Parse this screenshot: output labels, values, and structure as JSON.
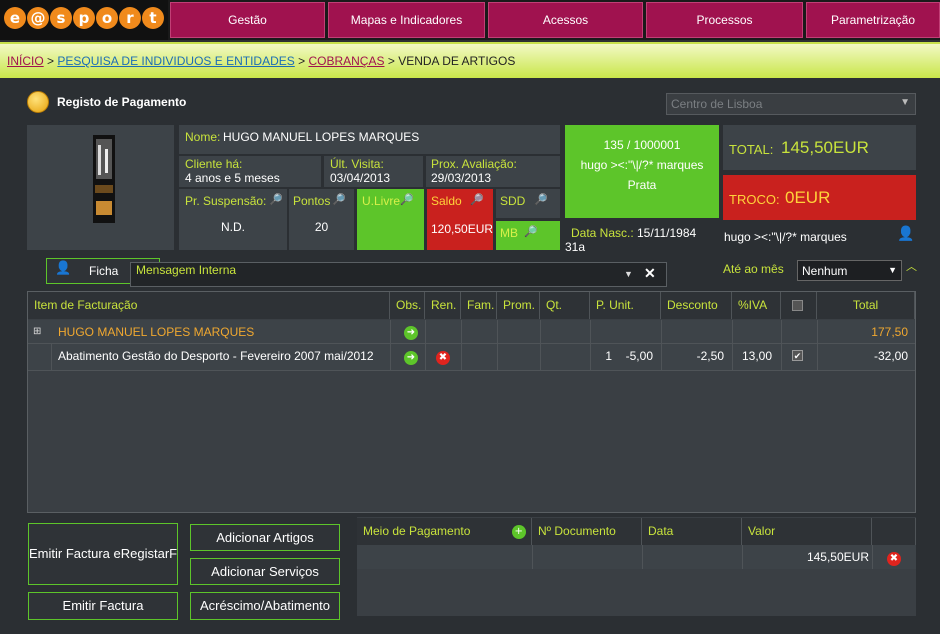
{
  "nav": {
    "logo_letters": [
      "e",
      "@",
      "s",
      "p",
      "o",
      "r",
      "t"
    ],
    "tabs": [
      "Gestão",
      "Mapas e Indicadores",
      "Acessos",
      "Processos",
      "Parametrização"
    ]
  },
  "breadcrumb": {
    "inicio": "INÍCIO",
    "sep": ">",
    "pesquisa": "PESQUISA DE INDIVIDUOS E ENTIDADES",
    "cobrancas": "COBRANÇAS",
    "current": "VENDA DE ARTIGOS"
  },
  "header": {
    "title": "Registo de Pagamento",
    "centro_placeholder": "Centro de Lisboa"
  },
  "member": {
    "name_label": "Nome:",
    "name": "HUGO MANUEL LOPES MARQUES",
    "cliente_label": "Cliente há:",
    "cliente_value": "4 anos e 5 meses",
    "ult_visita_label": "Últ. Visita:",
    "ult_visita_value": "03/04/2013",
    "prox_avaliacao_label": "Prox. Avaliação:",
    "prox_avaliacao_value": "29/03/2013",
    "suspensao_label": "Pr. Suspensão:",
    "suspensao_value": "N.D.",
    "pontos_label": "Pontos",
    "pontos_value": "20",
    "ulivre_label": "U.Livre",
    "saldo_label": "Saldo",
    "saldo_value": "120,50EUR",
    "sdd_label": "SDD",
    "mb_label": "MB",
    "card_line1": "135 / 1000001",
    "card_line2": "hugo ><:\"\\|/?* marques",
    "card_line3": "Prata",
    "data_nasc_label": "Data Nasc.:",
    "data_nasc_value": "15/11/1984",
    "age": "31a",
    "contact_name": "hugo ><:\"\\|/?* marques"
  },
  "totals": {
    "total_label": "TOTAL:",
    "total_value": "145,50EUR",
    "troco_label": "TROCO:",
    "troco_value": "0EUR"
  },
  "toolbar": {
    "ficha": "Ficha",
    "mensagem": "Mensagem Interna",
    "ate_ao_mes_label": "Até ao mês",
    "ate_ao_mes_value": "Nenhum"
  },
  "table": {
    "headers": [
      "Item de Facturação",
      "Obs.",
      "Ren.",
      "Fam.",
      "Prom.",
      "Qt.",
      "P. Unit.",
      "Desconto",
      "%IVA",
      "",
      "Total"
    ],
    "group_name": "HUGO MANUEL LOPES MARQUES",
    "group_total": "177,50",
    "item": {
      "description": "Abatimento Gestão do Desporto - Fevereiro 2007 mai/2012",
      "qt": "1",
      "p_unit": "-5,00",
      "desconto": "-2,50",
      "iva": "13,00",
      "total": "-32,00"
    }
  },
  "actions": {
    "emitir_registar": "Emitir Factura eRegistarF",
    "emitir": "Emitir Factura",
    "adicionar_artigos": "Adicionar Artigos",
    "adicionar_servicos": "Adicionar Serviços",
    "acrescimo": "Acréscimo/Abatimento"
  },
  "payments": {
    "headers": [
      "Meio de Pagamento",
      "Nº Documento",
      "Data",
      "Valor"
    ],
    "row_valor": "145,50EUR"
  }
}
